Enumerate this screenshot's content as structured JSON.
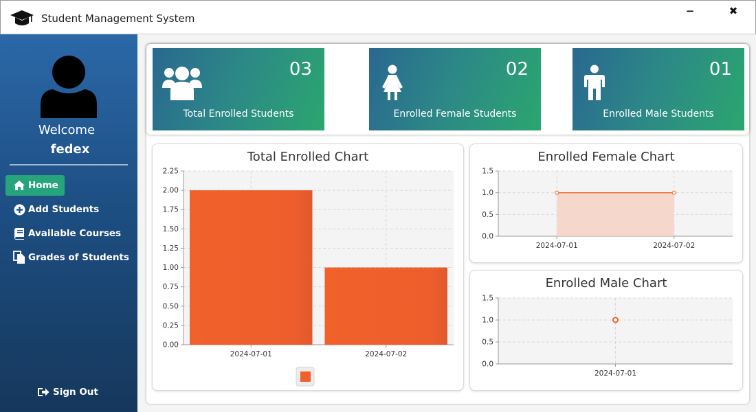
{
  "window": {
    "title": "Student Management System",
    "minimize_label": "−",
    "close_label": "✖"
  },
  "sidebar": {
    "welcome": "Welcome",
    "username": "fedex",
    "items": [
      {
        "label": "Home",
        "icon": "home-icon",
        "active": true
      },
      {
        "label": "Add Students",
        "icon": "plus-circle-icon",
        "active": false
      },
      {
        "label": "Available Courses",
        "icon": "book-icon",
        "active": false
      },
      {
        "label": "Grades of Students",
        "icon": "documents-icon",
        "active": false
      }
    ],
    "signout": "Sign Out"
  },
  "cards": [
    {
      "value": "03",
      "label": "Total Enrolled Students",
      "icon": "users-group-icon"
    },
    {
      "value": "02",
      "label": "Enrolled Female Students",
      "icon": "female-icon"
    },
    {
      "value": "01",
      "label": "Enrolled Male Students",
      "icon": "male-icon"
    }
  ],
  "colors": {
    "accent": "#f0612b",
    "active_nav": "#26a57d",
    "area_fill": "#f6d4c8"
  },
  "chart_data": [
    {
      "type": "bar",
      "title": "Total Enrolled Chart",
      "categories": [
        "2024-07-01",
        "2024-07-02"
      ],
      "values": [
        2,
        1
      ],
      "ylim": [
        0,
        2.25
      ],
      "yticks": [
        "0.00",
        "0.25",
        "0.50",
        "0.75",
        "1.00",
        "1.25",
        "1.50",
        "1.75",
        "2.00",
        "2.25"
      ],
      "grid": true,
      "legend": "bottom"
    },
    {
      "type": "area",
      "title": "Enrolled Female Chart",
      "categories": [
        "2024-07-01",
        "2024-07-02"
      ],
      "values": [
        1,
        1
      ],
      "ylim": [
        0,
        1.5
      ],
      "yticks": [
        "0.0",
        "0.5",
        "1.0",
        "1.5"
      ],
      "grid": true
    },
    {
      "type": "line",
      "title": "Enrolled Male Chart",
      "categories": [
        "2024-07-01"
      ],
      "values": [
        1
      ],
      "ylim": [
        0,
        1.5
      ],
      "yticks": [
        "0.0",
        "0.5",
        "1.0",
        "1.5"
      ],
      "grid": true
    }
  ]
}
